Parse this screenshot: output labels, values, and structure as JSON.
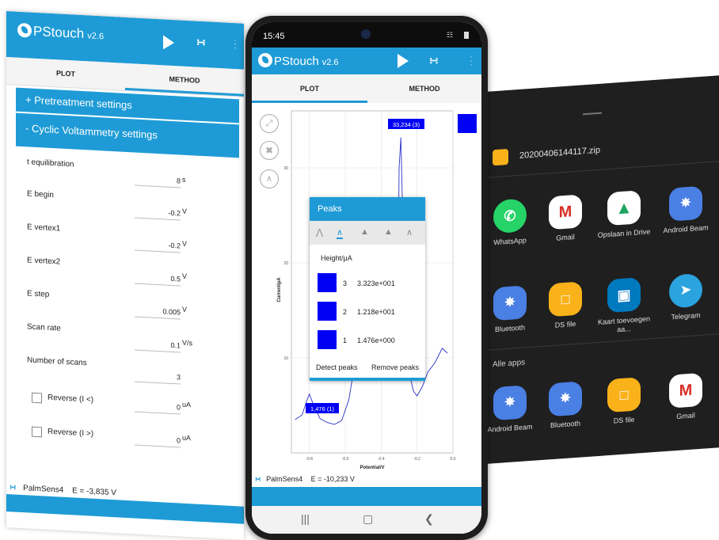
{
  "app": {
    "name": "PStouch",
    "version": "v2.6"
  },
  "left_tablet": {
    "tabs": [
      {
        "label": "PLOT"
      },
      {
        "label": "METHOD"
      }
    ],
    "sections": [
      {
        "label": "+ Pretreatment settings"
      },
      {
        "label": "- Cyclic Voltammetry settings"
      }
    ],
    "fields": [
      {
        "label": "t equilibration",
        "value": "8",
        "unit": "s"
      },
      {
        "label": "E begin",
        "value": "-0.2",
        "unit": "V"
      },
      {
        "label": "E vertex1",
        "value": "-0.2",
        "unit": "V"
      },
      {
        "label": "E vertex2",
        "value": "0.5",
        "unit": "V"
      },
      {
        "label": "E step",
        "value": "0.005",
        "unit": "V"
      },
      {
        "label": "Scan rate",
        "value": "0.1",
        "unit": "V/s"
      },
      {
        "label": "Number of scans",
        "value": "3",
        "unit": ""
      }
    ],
    "checkboxes": [
      {
        "label": "Reverse (I <)",
        "value": "0",
        "unit": "uA"
      },
      {
        "label": "Reverse (I >)",
        "value": "0",
        "unit": "uA"
      }
    ],
    "footer": {
      "device": "PalmSens4",
      "status": "E = -3,835 V"
    }
  },
  "phone": {
    "status_bar": {
      "time": "15:45"
    },
    "tabs": [
      {
        "label": "PLOT"
      },
      {
        "label": "METHOD"
      }
    ],
    "peaks_dialog": {
      "title": "Peaks",
      "column_header": "Height/μA",
      "rows": [
        {
          "index": "3",
          "value": "3.323e+001"
        },
        {
          "index": "2",
          "value": "1.218e+001"
        },
        {
          "index": "1",
          "value": "1.476e+000"
        }
      ],
      "detect_label": "Detect peaks",
      "remove_label": "Remove peaks"
    },
    "footer": {
      "device": "PalmSens4",
      "status": "E = -10,233 V"
    }
  },
  "chart_data": {
    "type": "line",
    "xlabel": "Potential/V",
    "ylabel": "Current/μA",
    "x_ticks": [
      "-0.8",
      "-0.6",
      "-0.4",
      "-0.2",
      "0.0"
    ],
    "y_ticks": [
      "10",
      "20",
      "30"
    ],
    "xlim": [
      -0.9,
      0.0
    ],
    "ylim": [
      0,
      36
    ],
    "series": [
      {
        "x": [
          -0.88,
          -0.84,
          -0.82,
          -0.8,
          -0.78,
          -0.74,
          -0.7,
          -0.66,
          -0.62,
          -0.58,
          -0.55,
          -0.52,
          -0.5,
          -0.48,
          -0.45,
          -0.42,
          -0.4,
          -0.37,
          -0.35,
          -0.33,
          -0.31,
          -0.3,
          -0.29,
          -0.28,
          -0.27,
          -0.25,
          -0.22,
          -0.2,
          -0.17,
          -0.14,
          -0.1,
          -0.06,
          -0.03
        ],
        "y": [
          3.5,
          4.0,
          5.2,
          6.2,
          5.2,
          3.6,
          3.2,
          3.0,
          3.4,
          5.6,
          9.0,
          11.0,
          8.0,
          9.2,
          11.6,
          9.8,
          9.0,
          11.2,
          20.5,
          12.0,
          8.0,
          30.0,
          33.2,
          25.0,
          12.0,
          9.0,
          6.5,
          6.0,
          7.0,
          8.5,
          9.5,
          11.0,
          10.5
        ]
      }
    ],
    "annotations": [
      "33,234 (3)",
      "1,476 (1)"
    ],
    "legend_color": "#0000f5"
  },
  "share_sheet": {
    "file_name": "20200406144117.zip",
    "apps_row1": [
      {
        "label": "WhatsApp",
        "icon": "whatsapp-icon",
        "color": "#25d366"
      },
      {
        "label": "Gmail",
        "icon": "gmail-icon",
        "color": "#ffffff"
      },
      {
        "label": "Opslaan in Drive",
        "icon": "google-drive-icon",
        "color": "#ffffff"
      },
      {
        "label": "Android Beam",
        "icon": "bluetooth-icon",
        "color": "#4a7fe4"
      }
    ],
    "apps_row2": [
      {
        "label": "Bluetooth",
        "icon": "bluetooth-icon",
        "color": "#4a7fe4"
      },
      {
        "label": "DS file",
        "icon": "folder-icon",
        "color": "#f9b21a"
      },
      {
        "label": "Kaart toevoegen aa...",
        "icon": "trello-icon",
        "color": "#0079bf"
      },
      {
        "label": "Telegram",
        "icon": "telegram-icon",
        "color": "#2aa3df"
      }
    ],
    "all_apps_label": "Alle apps",
    "apps_row3": [
      {
        "label": "Android Beam",
        "icon": "bluetooth-icon",
        "color": "#4a7fe4"
      },
      {
        "label": "Bluetooth",
        "icon": "bluetooth-icon",
        "color": "#4a7fe4"
      },
      {
        "label": "DS file",
        "icon": "folder-icon",
        "color": "#f9b21a"
      },
      {
        "label": "Gmail",
        "icon": "gmail-icon",
        "color": "#ffffff"
      }
    ]
  }
}
